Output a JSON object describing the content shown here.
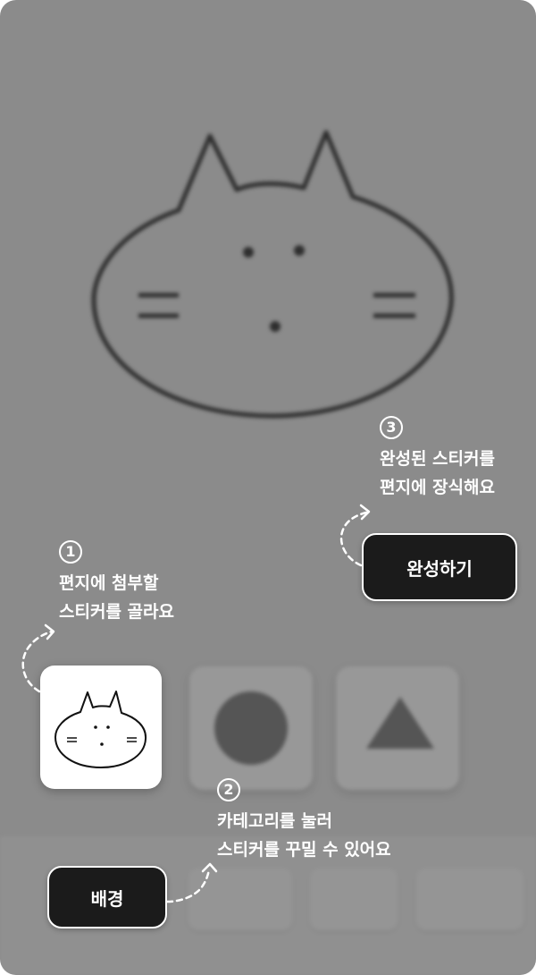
{
  "steps": [
    {
      "number": "1",
      "line1": "편지에 첨부할",
      "line2": "스티커를 골라요"
    },
    {
      "number": "2",
      "line1": "카테고리를 눌러",
      "line2": "스티커를 꾸밀 수 있어요"
    },
    {
      "number": "3",
      "line1": "완성된 스티커를",
      "line2": "편지에 장식해요"
    }
  ],
  "buttons": {
    "complete_label": "완성하기",
    "background_label": "배경"
  },
  "colors": {
    "button_bg": "#1b1b1b",
    "overlay": "rgba(40,40,40,0.45)",
    "guide_text": "#ffffff"
  },
  "icons": {
    "preview": "cat-face-drawing",
    "sticker_options": [
      "cat-sticker-icon",
      "circle-shape-icon",
      "triangle-shape-icon"
    ]
  }
}
